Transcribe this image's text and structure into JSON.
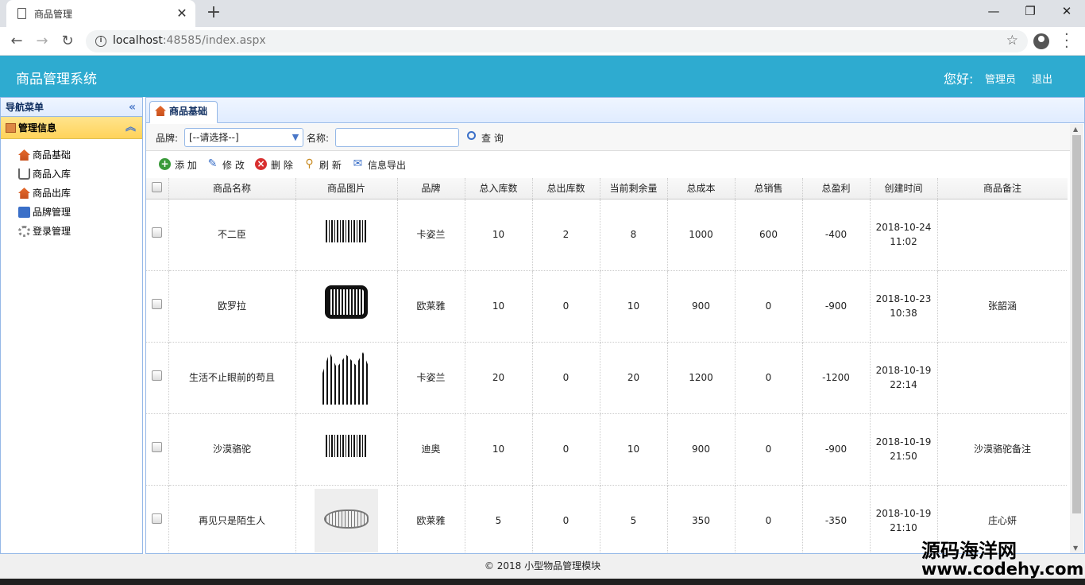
{
  "browser": {
    "tab_title": "商品管理",
    "tab_close": "✕",
    "new_tab": "+",
    "url_host": "localhost",
    "url_rest": ":48585/index.aspx",
    "minimize": "—",
    "restore": "❐",
    "close": "✕"
  },
  "header": {
    "system_name": "商品管理系统",
    "greeting": "您好:",
    "user": "管理员",
    "logout": "退出"
  },
  "sidebar": {
    "title": "导航菜单",
    "group": "管理信息",
    "items": [
      {
        "label": "商品基础",
        "icon": "home-icon"
      },
      {
        "label": "商品入库",
        "icon": "cart-icon"
      },
      {
        "label": "商品出库",
        "icon": "home-icon"
      },
      {
        "label": "品牌管理",
        "icon": "book-icon"
      },
      {
        "label": "登录管理",
        "icon": "gear-icon"
      }
    ]
  },
  "main": {
    "tab": "商品基础",
    "search": {
      "brand_label": "品牌:",
      "brand_value": "[--请选择--]",
      "name_label": "名称:",
      "name_value": "",
      "query": "查 询"
    },
    "actions": {
      "add": "添 加",
      "edit": "修 改",
      "delete": "删 除",
      "refresh": "刷 新",
      "export": "信息导出"
    },
    "columns": [
      "商品名称",
      "商品图片",
      "品牌",
      "总入库数",
      "总出库数",
      "当前剩余量",
      "总成本",
      "总销售",
      "总盈利",
      "创建时间",
      "商品备注"
    ],
    "rows": [
      {
        "name": "不二臣",
        "brand": "卡姿兰",
        "in": "10",
        "out": "2",
        "remain": "8",
        "cost": "1000",
        "sales": "600",
        "profit": "-400",
        "date": "2018-10-24",
        "time": "11:02",
        "note": "",
        "img": "barcode-music"
      },
      {
        "name": "欧罗拉",
        "brand": "欧莱雅",
        "in": "10",
        "out": "0",
        "remain": "10",
        "cost": "900",
        "sales": "0",
        "profit": "-900",
        "date": "2018-10-23",
        "time": "10:38",
        "note": "张韶涵",
        "img": "barcode-tv"
      },
      {
        "name": "生活不止眼前的苟且",
        "brand": "卡姿兰",
        "in": "20",
        "out": "0",
        "remain": "20",
        "cost": "1200",
        "sales": "0",
        "profit": "-1200",
        "date": "2018-10-19",
        "time": "22:14",
        "note": "",
        "img": "barcode-tree"
      },
      {
        "name": "沙漠骆驼",
        "brand": "迪奥",
        "in": "10",
        "out": "0",
        "remain": "10",
        "cost": "900",
        "sales": "0",
        "profit": "-900",
        "date": "2018-10-19",
        "time": "21:50",
        "note": "沙漠骆驼备注",
        "img": "barcode-music"
      },
      {
        "name": "再见只是陌生人",
        "brand": "欧莱雅",
        "in": "5",
        "out": "0",
        "remain": "5",
        "cost": "350",
        "sales": "0",
        "profit": "-350",
        "date": "2018-10-19",
        "time": "21:10",
        "note": "庄心妍",
        "img": "barcode-fish"
      }
    ]
  },
  "footer": "© 2018 小型物品管理模块",
  "watermark": {
    "line1": "源码海洋网",
    "line2": "www.codehy.com"
  }
}
